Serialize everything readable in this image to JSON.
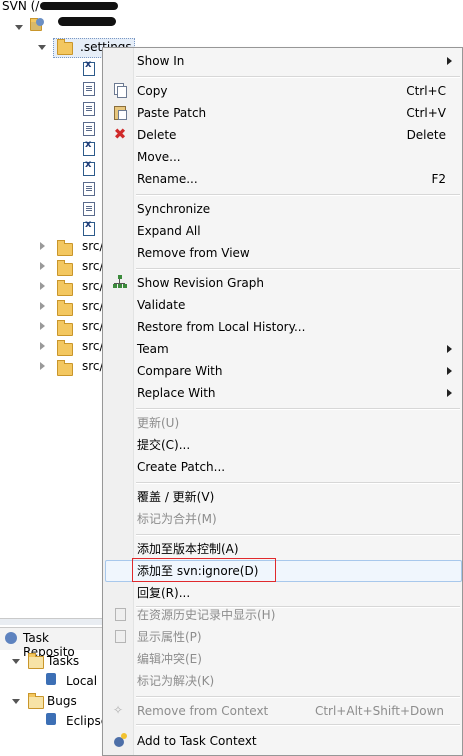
{
  "tree": {
    "root_label": "SVN (/",
    "project_label": ".settings",
    "src_items": [
      "src/",
      "src/",
      "src/",
      "src/",
      "src/",
      "src/",
      "src/"
    ],
    "file_kinds": [
      "x",
      "f",
      "f",
      "f",
      "x",
      "x",
      "f",
      "f",
      "x"
    ]
  },
  "bottom_panel": {
    "title": "Task Reposito",
    "tasks_label": "Tasks",
    "local_label": "Local",
    "bugs_label": "Bugs",
    "eclipse_label": "Eclipse"
  },
  "menu": {
    "show_in": "Show In",
    "copy": "Copy",
    "copy_acc": "Ctrl+C",
    "paste_patch": "Paste Patch",
    "paste_acc": "Ctrl+V",
    "delete": "Delete",
    "delete_acc": "Delete",
    "move": "Move...",
    "rename": "Rename...",
    "rename_acc": "F2",
    "synchronize": "Synchronize",
    "expand_all": "Expand All",
    "remove_from_view": "Remove from View",
    "show_revision_graph": "Show Revision Graph",
    "validate": "Validate",
    "restore_local_history": "Restore from Local History...",
    "team": "Team",
    "compare_with": "Compare With",
    "replace_with": "Replace With",
    "update": "更新(U)",
    "commit": "提交(C)...",
    "create_patch": "Create Patch...",
    "override_update": "覆盖 / 更新(V)",
    "mark_merged": "标记为合并(M)",
    "add_to_vc": "添加至版本控制(A)",
    "add_to_ignore": "添加至 svn:ignore(D)",
    "revert": "回复(R)...",
    "show_in_history": "在资源历史记录中显示(H)",
    "show_properties": "显示属性(P)",
    "edit_conflict": "编辑冲突(E)",
    "mark_resolved": "标记为解决(K)",
    "remove_from_context": "Remove from Context",
    "remove_context_acc": "Ctrl+Alt+Shift+Down",
    "add_to_task_context": "Add to Task Context"
  }
}
